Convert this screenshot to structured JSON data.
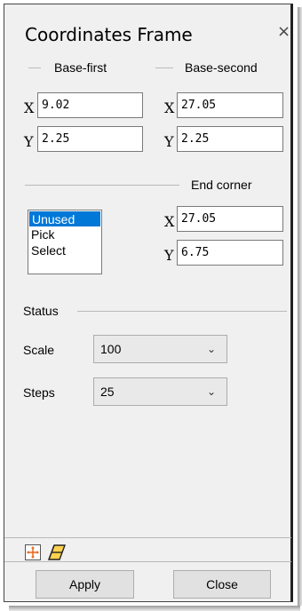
{
  "window": {
    "title": "Coordinates Frame",
    "close_glyph": "×"
  },
  "base_first": {
    "label": "Base-first",
    "x": {
      "axis": "X",
      "value": "9.02"
    },
    "y": {
      "axis": "Y",
      "value": "2.25"
    }
  },
  "base_second": {
    "label": "Base-second",
    "x": {
      "axis": "X",
      "value": "27.05"
    },
    "y": {
      "axis": "Y",
      "value": "2.25"
    }
  },
  "end_corner": {
    "label": "End corner",
    "x": {
      "axis": "X",
      "value": "27.05"
    },
    "y": {
      "axis": "Y",
      "value": "6.75"
    }
  },
  "mode_list": {
    "items": [
      "Unused",
      "Pick",
      "Select"
    ],
    "selected": "Unused"
  },
  "status": {
    "label": "Status",
    "scale": {
      "label": "Scale",
      "value": "100"
    },
    "steps": {
      "label": "Steps",
      "value": "25"
    }
  },
  "toolbar": {
    "icons": [
      "move-crosshair-icon",
      "eraser-icon"
    ]
  },
  "buttons": {
    "apply": "Apply",
    "close": "Close"
  },
  "colors": {
    "selection": "#0078d7",
    "panel_bg": "#f0f0f0"
  }
}
